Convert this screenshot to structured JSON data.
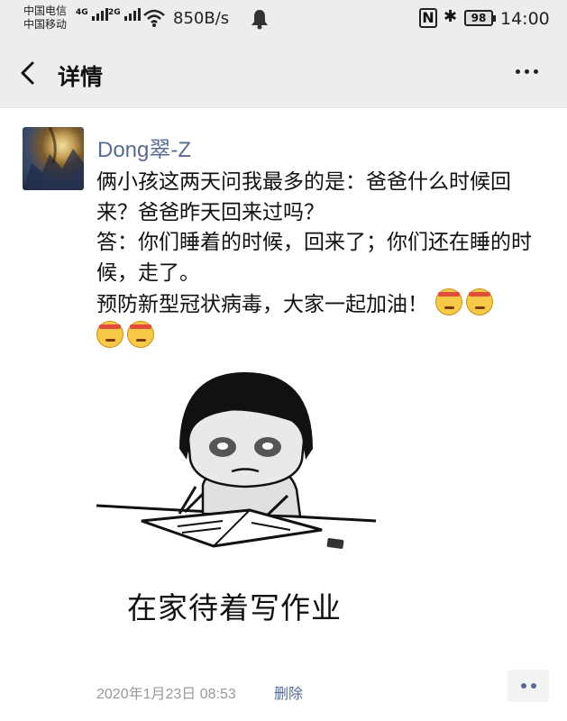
{
  "status_bar": {
    "carrier1": "中国电信",
    "carrier2": "中国移动",
    "net1": "4G",
    "net2": "2G",
    "speed": "850B/s",
    "battery": "98",
    "time": "14:00",
    "icons": [
      "signal-icon",
      "wifi-icon",
      "notification-bell-icon",
      "nfc-icon",
      "bluetooth-icon",
      "battery-icon"
    ]
  },
  "nav": {
    "title": "详情",
    "back_icon": "chevron-left-icon",
    "more_icon": "more-icon"
  },
  "post": {
    "username": "Dong翠-Z",
    "text": "俩小孩这两天问我最多的是：爸爸什么时候回来？爸爸昨天回来过吗？\n答：你们睡着的时候，回来了；你们还在睡的时候，走了。\n预防新型冠状病毒，大家一起加油！",
    "emoji_name": "head-bandage-emoji",
    "emoji_count": 4,
    "image_caption": "在家待着写作业",
    "timestamp": "2020年1月23日 08:53",
    "delete_label": "删除"
  },
  "colors": {
    "link": "#576b95",
    "bar_bg": "#ededed",
    "meta": "#999999"
  }
}
